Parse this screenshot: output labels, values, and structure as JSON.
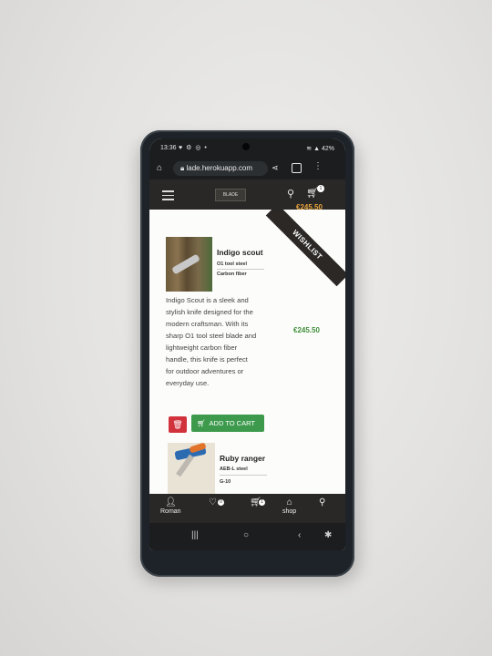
{
  "statusbar": {
    "time": "13:36",
    "icons": "♥ ⚙ ◎ •",
    "battery": "≋ ▲ 42%"
  },
  "browser": {
    "url": "lade.herokuapp.com",
    "tab_count": ""
  },
  "header": {
    "logo_text": "BLADE",
    "cart_count": "1",
    "cart_total": "€245.50"
  },
  "ribbon": {
    "label": "WISHLIST"
  },
  "products": [
    {
      "name": "Indigo scout",
      "steel": "O1 tool steel",
      "handle": "Carbon fiber",
      "description": "Indigo Scout is a sleek and stylish knife designed for the modern craftsman. With its sharp O1 tool steel blade and lightweight carbon fiber handle, this knife is perfect for outdoor adventures or everyday use.",
      "price": "€245.50",
      "add_to_cart_label": "ADD TO CART"
    },
    {
      "name": "Ruby ranger",
      "steel": "AEB-L steel",
      "size": "G-10"
    }
  ],
  "bottom_nav": {
    "user_label": "Roman",
    "wishlist_count": "0",
    "cart_count": "1",
    "shop_label": "shop"
  },
  "colors": {
    "header_bg": "#2a2826",
    "price_green": "#3f8f3a",
    "total_orange": "#e6a33c",
    "add_btn": "#3d9a4d",
    "delete_btn": "#d2323c"
  }
}
